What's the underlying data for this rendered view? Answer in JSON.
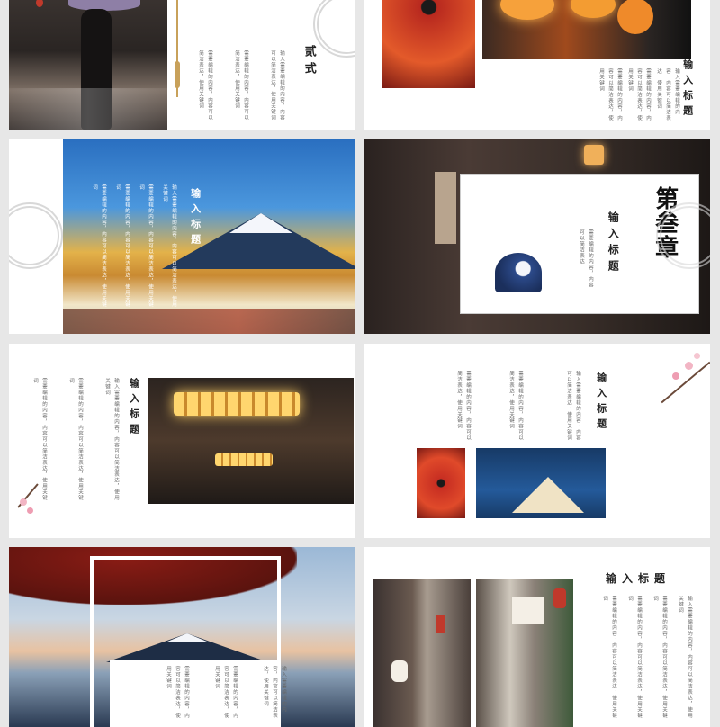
{
  "slides": {
    "s1": {
      "chapter_heading": "贰式",
      "paragraphs": [
        "输入需要编辑的内容，内容可以简洁表达，使用关键词",
        "需要编辑的内容，内容可以简洁表达，使用关键词",
        "需要编辑的内容，内容可以简洁表达，使用关键词"
      ]
    },
    "s2": {
      "heading": "输入标题",
      "paragraphs": [
        "输入需要编辑的内容，内容可以简洁表达，使用关键词",
        "需要编辑的内容，内容可以简洁表达，使用关键词",
        "需要编辑的内容，内容可以简洁表达，使用关键词"
      ]
    },
    "s3": {
      "heading": "输入标题",
      "paragraphs": [
        "输入需要编辑的内容，内容可以简洁表达，使用关键词",
        "需要编辑的内容，内容可以简洁表达，使用关键词",
        "需要编辑的内容，内容可以简洁表达，使用关键词",
        "需要编辑的内容，内容可以简洁表达，使用关键词"
      ]
    },
    "s4": {
      "chapter_heading": "第叁章",
      "heading": "输入标题",
      "paragraphs": [
        "需要编辑的内容，内容可以简洁表达"
      ]
    },
    "s5": {
      "heading": "输入标题",
      "paragraphs": [
        "输入需要编辑的内容，内容可以简洁表达，使用关键词",
        "需要编辑的内容，内容可以简洁表达，使用关键词",
        "需要编辑的内容，内容可以简洁表达，使用关键词"
      ]
    },
    "s6": {
      "heading": "输入标题",
      "paragraphs": [
        "输入需要编辑的内容，内容可以简洁表达，使用关键词",
        "需要编辑的内容，内容可以简洁表达，使用关键词",
        "需要编辑的内容，内容可以简洁表达，使用关键词"
      ]
    },
    "s7": {
      "paragraphs": [
        "输入需要编辑的内容，内容可以简洁表达，使用关键词",
        "需要编辑的内容，内容可以简洁表达，使用关键词",
        "需要编辑的内容，内容可以简洁表达，使用关键词"
      ]
    },
    "s8": {
      "heading": "输入标题",
      "paragraphs": [
        "输入需要编辑的内容，内容可以简洁表达，使用关键词",
        "需要编辑的内容，内容可以简洁表达，使用关键词",
        "需要编辑的内容，内容可以简洁表达，使用关键词",
        "需要编辑的内容，内容可以简洁表达，使用关键词"
      ]
    }
  },
  "colors": {
    "background": "#e7e7e7",
    "accent_gold": "#c8a15a",
    "seal_gray": "#d8d8d8"
  }
}
